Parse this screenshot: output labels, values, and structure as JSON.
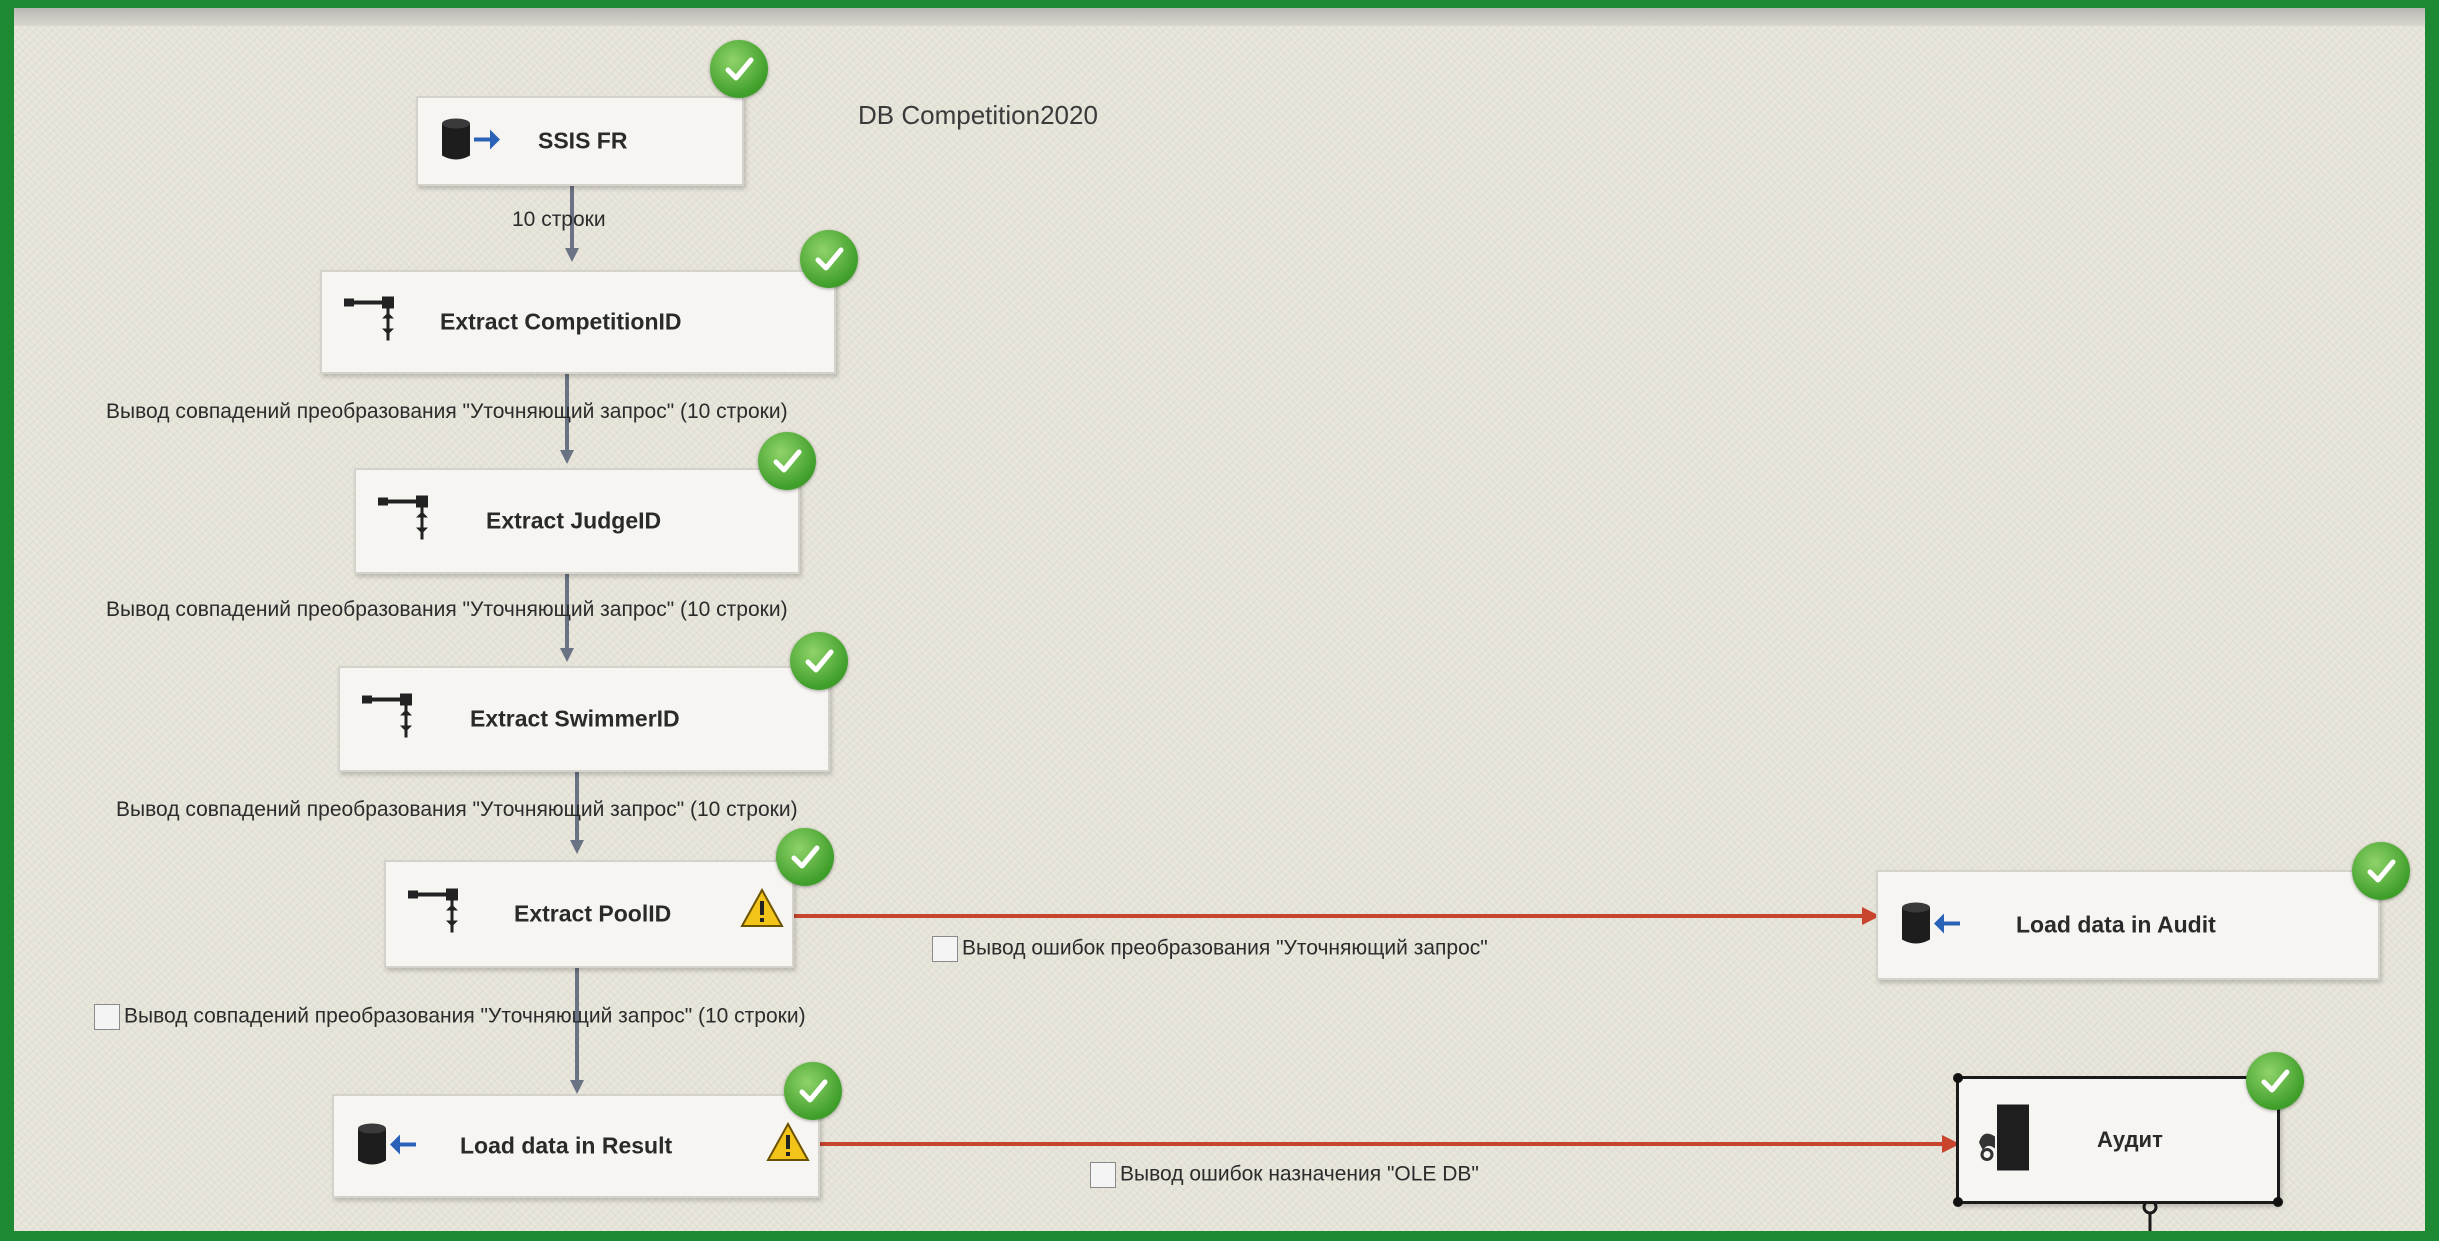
{
  "canvas": {
    "annotation": "DB Competition2020"
  },
  "tasks": {
    "ssis_fr": {
      "label": "SSIS FR"
    },
    "extract_competition": {
      "label": "Extract CompetitionID"
    },
    "extract_judge": {
      "label": "Extract JudgeID"
    },
    "extract_swimmer": {
      "label": "Extract SwimmerID"
    },
    "extract_pool": {
      "label": "Extract PoolID"
    },
    "load_result": {
      "label": "Load data in Result"
    },
    "load_audit": {
      "label": "Load data in Audit"
    },
    "audit": {
      "label": "Аудит"
    }
  },
  "flows": {
    "f1": "10 строки",
    "f2": "Вывод совпадений преобразования \"Уточняющий запрос\" (10 строки)",
    "f3": "Вывод совпадений преобразования \"Уточняющий запрос\" (10 строки)",
    "f4": "Вывод совпадений преобразования \"Уточняющий запрос\" (10 строки)",
    "f5": "Вывод совпадений преобразования \"Уточняющий запрос\" (10 строки)",
    "error_pool": "Вывод ошибок преобразования \"Уточняющий запрос\"",
    "error_result": "Вывод ошибок назначения \"OLE DB\""
  },
  "icons": {
    "status": "success-check-icon",
    "warning": "warning-icon",
    "source": "oledb-source-icon",
    "destination": "oledb-destination-icon",
    "lookup": "lookup-icon",
    "data_viewer": "data-viewer-icon"
  },
  "colors": {
    "canvas": "#e9e6dc",
    "flow_normal": "#6a7384",
    "flow_error": "#c8442d",
    "success": "#3f9e2a",
    "warning": "#f2c318"
  }
}
